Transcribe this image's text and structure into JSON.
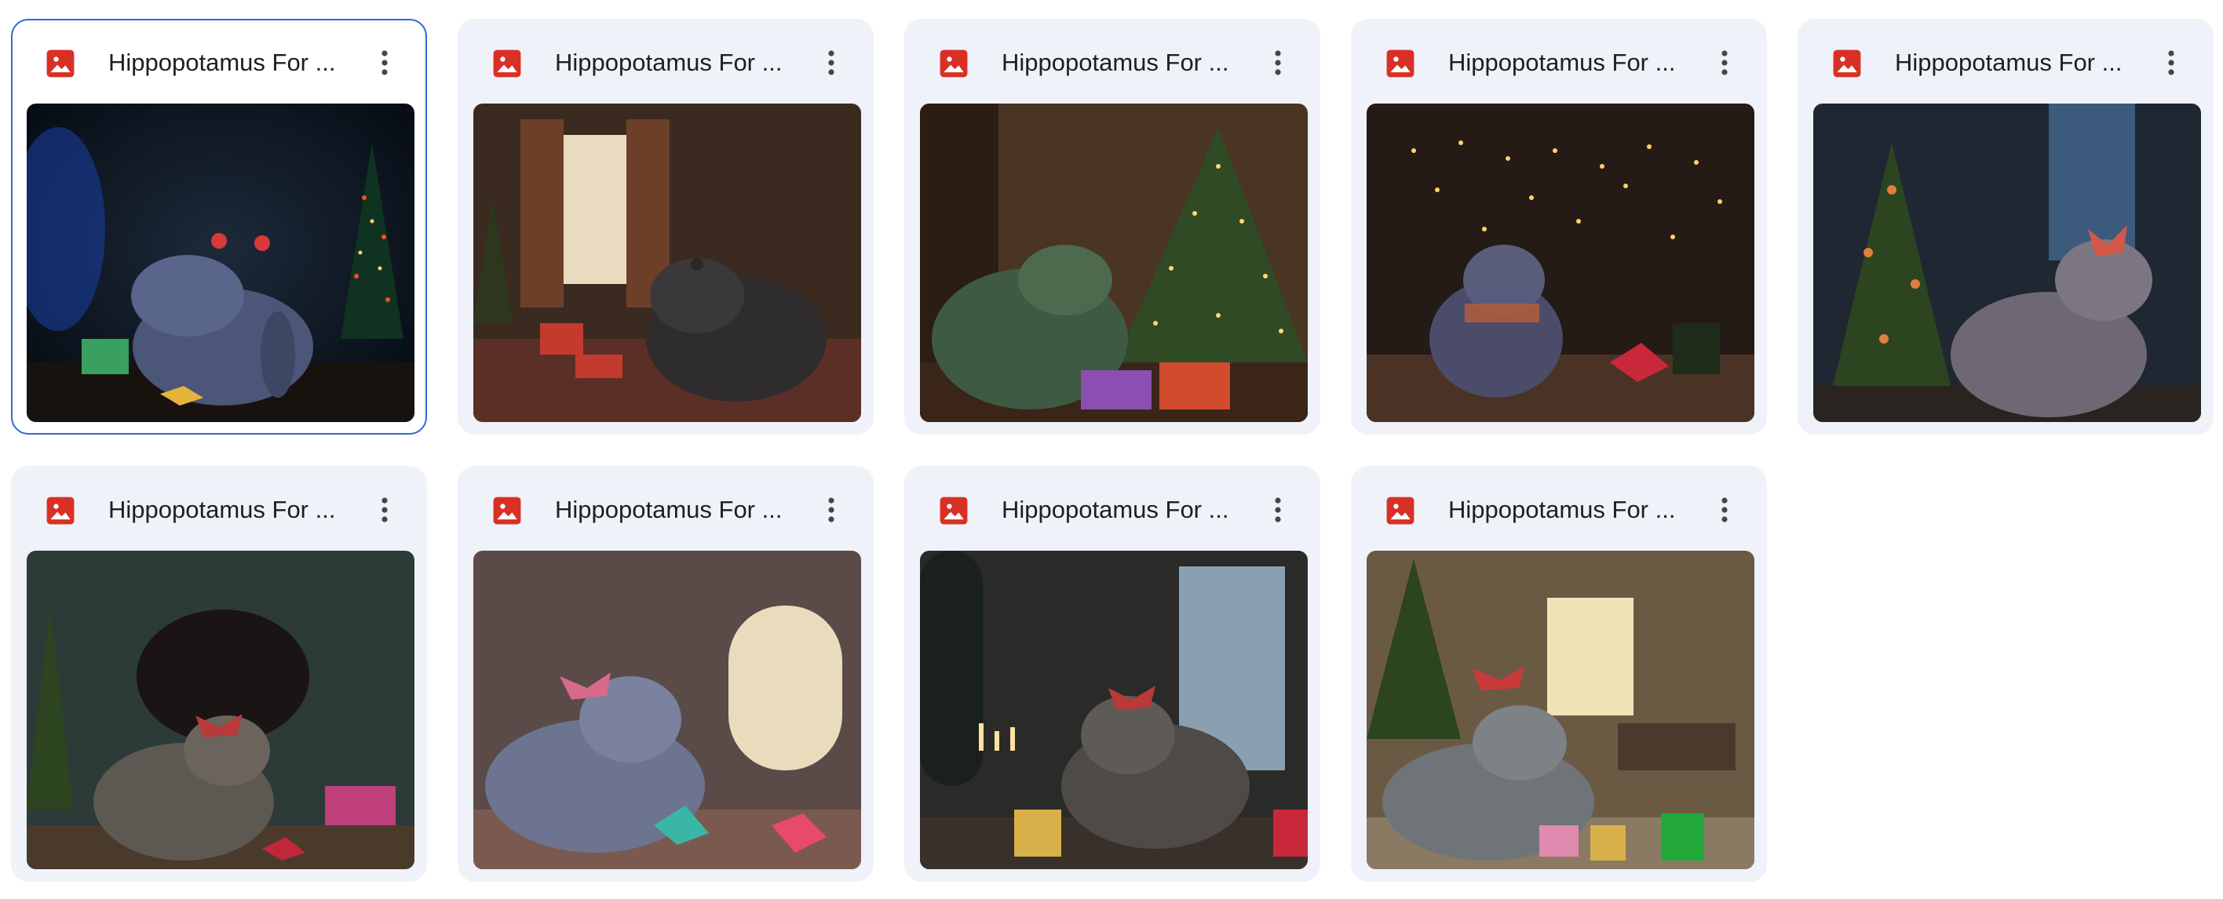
{
  "files": [
    {
      "name": "Hippopotamus For ...",
      "type_icon": "image-file-icon",
      "selected": true
    },
    {
      "name": "Hippopotamus For ...",
      "type_icon": "image-file-icon",
      "selected": false
    },
    {
      "name": "Hippopotamus For ...",
      "type_icon": "image-file-icon",
      "selected": false
    },
    {
      "name": "Hippopotamus For ...",
      "type_icon": "image-file-icon",
      "selected": false
    },
    {
      "name": "Hippopotamus For ...",
      "type_icon": "image-file-icon",
      "selected": false
    },
    {
      "name": "Hippopotamus For ...",
      "type_icon": "image-file-icon",
      "selected": false
    },
    {
      "name": "Hippopotamus For ...",
      "type_icon": "image-file-icon",
      "selected": false
    },
    {
      "name": "Hippopotamus For ...",
      "type_icon": "image-file-icon",
      "selected": false
    },
    {
      "name": "Hippopotamus For ...",
      "type_icon": "image-file-icon",
      "selected": false
    }
  ],
  "colors": {
    "card_background": "#eff2f8",
    "selected_border": "#2e6bd8",
    "image_icon": "#d93025",
    "text": "#1f1f1f"
  }
}
